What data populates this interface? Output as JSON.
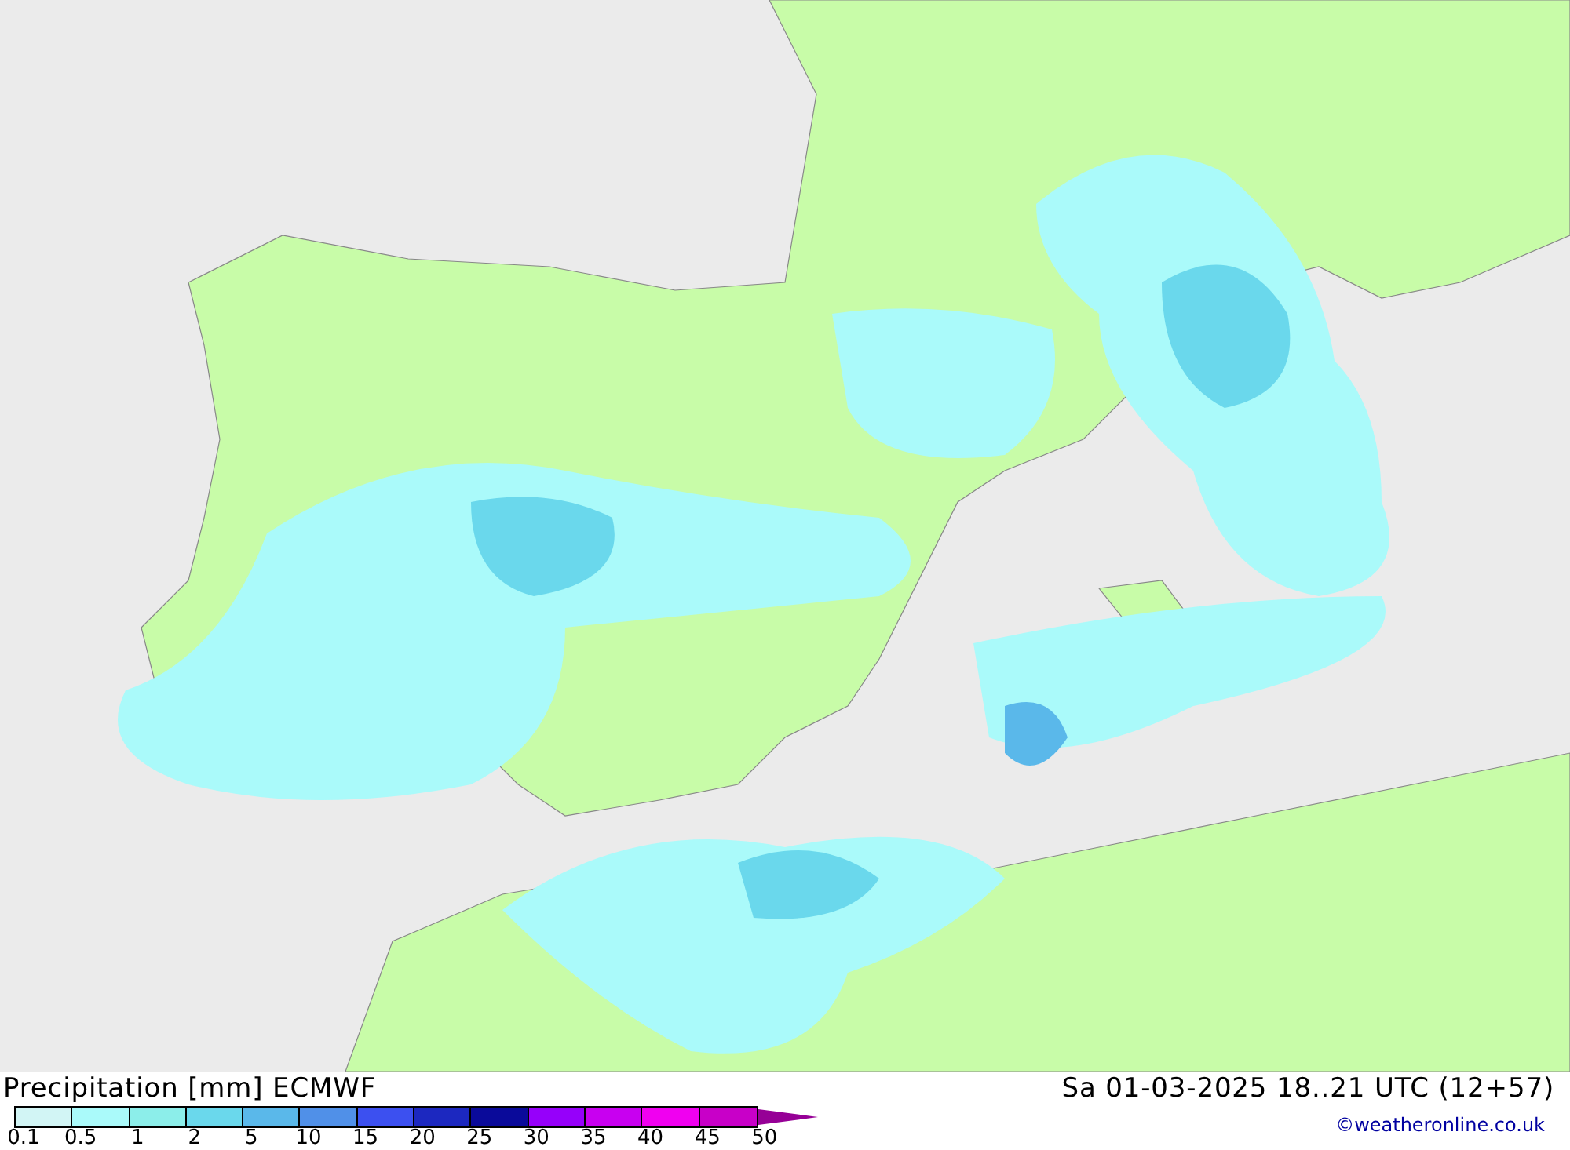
{
  "title": "Precipitation [mm] ECMWF",
  "legend": {
    "bins": [
      {
        "color": "#d2f5f5"
      },
      {
        "color": "#aafafa"
      },
      {
        "color": "#8ceeea"
      },
      {
        "color": "#6ad8ec"
      },
      {
        "color": "#5ab8ea"
      },
      {
        "color": "#5090e8"
      },
      {
        "color": "#3c50f0"
      },
      {
        "color": "#1c28c0"
      },
      {
        "color": "#0a0a9a"
      },
      {
        "color": "#9600fa"
      },
      {
        "color": "#c800f0"
      },
      {
        "color": "#f000f0"
      },
      {
        "color": "#c800c8"
      }
    ],
    "labels": [
      "0.1",
      "0.5",
      "1",
      "2",
      "5",
      "10",
      "15",
      "20",
      "25",
      "30",
      "35",
      "40",
      "45",
      "50"
    ]
  },
  "valid_time": "Sa 01-03-2025 18..21 UTC (12+57)",
  "credit": "©weatheronline.co.uk"
}
